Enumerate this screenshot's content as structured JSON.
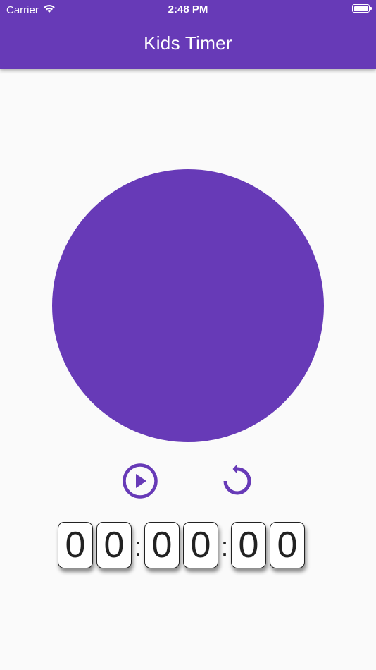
{
  "status_bar": {
    "carrier": "Carrier",
    "time": "2:48 PM",
    "icons": [
      "wifi-icon",
      "battery-icon"
    ]
  },
  "app_bar": {
    "title": "Kids Timer"
  },
  "colors": {
    "primary": "#673ab7",
    "background": "#fafafa",
    "digit_text": "#222222"
  },
  "controls": {
    "play_icon": "play-circle-icon",
    "reset_icon": "replay-icon"
  },
  "timer": {
    "hours": [
      "0",
      "0"
    ],
    "separator_1": ":",
    "minutes": [
      "0",
      "0"
    ],
    "separator_2": ":",
    "seconds": [
      "0",
      "0"
    ]
  }
}
